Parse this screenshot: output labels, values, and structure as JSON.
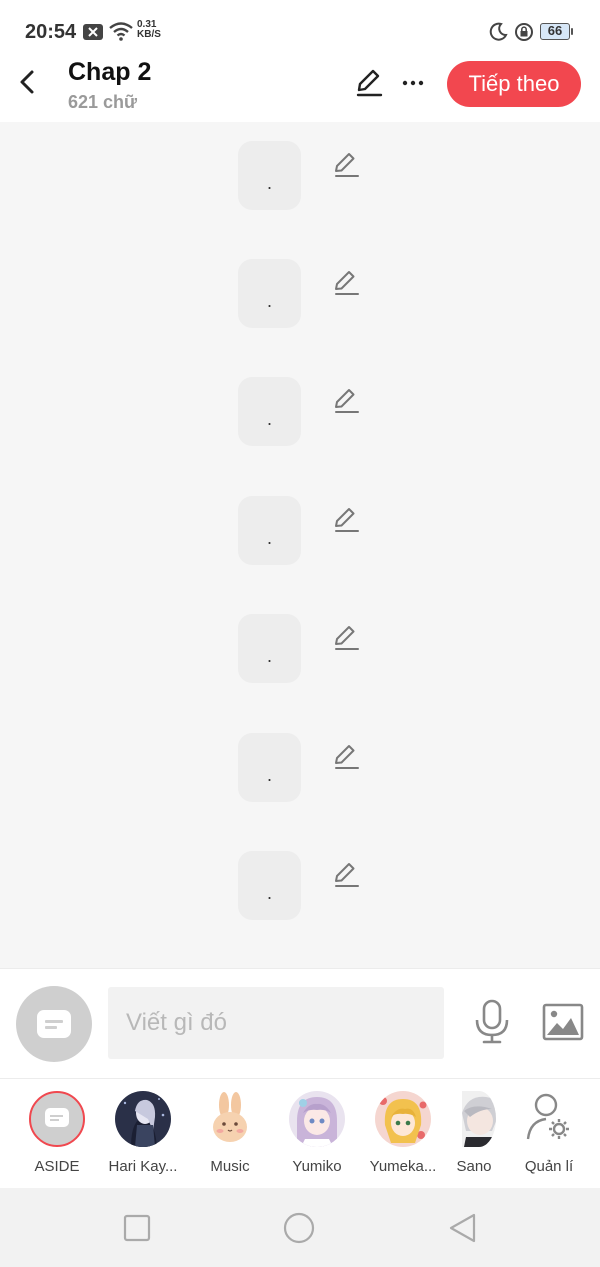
{
  "status_bar": {
    "time": "20:54",
    "net_speed_value": "0.31",
    "net_speed_unit": "KB/S",
    "battery": "66",
    "icons": [
      "notification-x-icon",
      "wifi-icon",
      "moon-icon",
      "rotation-lock-icon",
      "battery-icon"
    ]
  },
  "header": {
    "title": "Chap 2",
    "word_count": "621 chữ",
    "next_label": "Tiếp theo",
    "accent_color": "#f2474f"
  },
  "messages": [
    {
      "text": "."
    },
    {
      "text": "."
    },
    {
      "text": "."
    },
    {
      "text": "."
    },
    {
      "text": "."
    },
    {
      "text": "."
    },
    {
      "text": "."
    }
  ],
  "composer": {
    "placeholder": "Viết gì đó"
  },
  "characters": [
    {
      "label": "ASIDE",
      "selected": true
    },
    {
      "label": "Hari Kay..."
    },
    {
      "label": "Music"
    },
    {
      "label": "Yumiko"
    },
    {
      "label": "Yumeka..."
    },
    {
      "label": "Sano"
    }
  ],
  "manage_label": "Quản lí",
  "colors": {
    "background": "#f6f6f6",
    "bubble": "#ededed",
    "selected_ring": "#f0484f"
  }
}
